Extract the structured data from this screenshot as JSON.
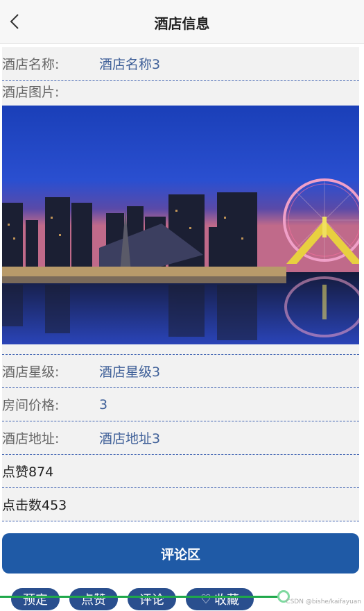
{
  "header": {
    "title": "酒店信息"
  },
  "fields": {
    "name_label": "酒店名称:",
    "name_value": "酒店名称3",
    "image_label": "酒店图片:",
    "star_label": "酒店星级:",
    "star_value": "酒店星级3",
    "price_label": "房间价格:",
    "price_value": "3",
    "address_label": "酒店地址:",
    "address_value": "酒店地址3",
    "likes": "点赞874",
    "clicks": "点击数453"
  },
  "comment_button": "评论区",
  "actions": {
    "book": "预定",
    "like": "点赞",
    "comment": "评论",
    "favorite": "收藏"
  },
  "watermark": "CSDN @bishe/kaifayuan",
  "colors": {
    "primary": "#1f5aa6",
    "value_text": "#3e5f98",
    "divider": "#3b5fb0"
  }
}
